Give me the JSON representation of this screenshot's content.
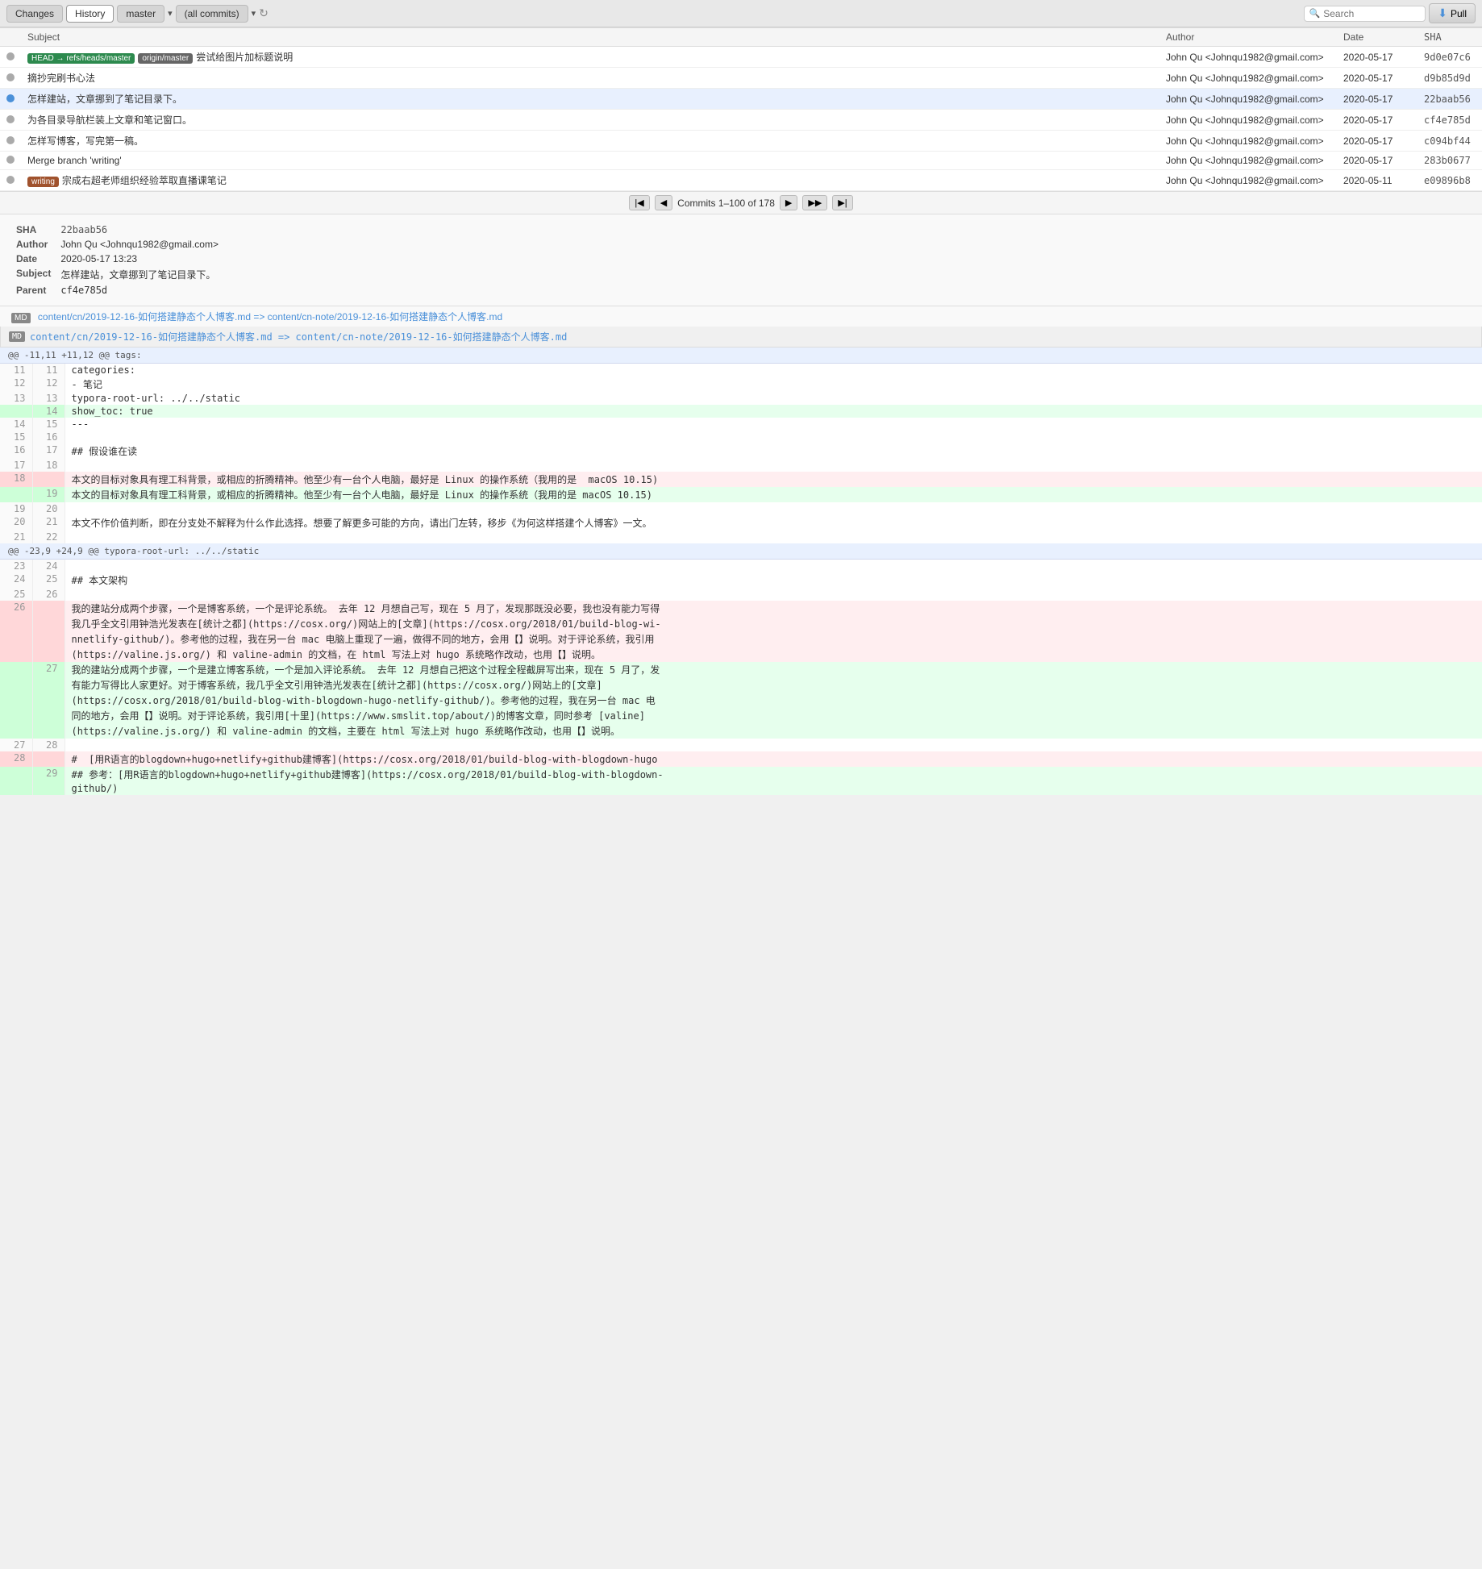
{
  "toolbar": {
    "changes_label": "Changes",
    "history_label": "History",
    "branch": "master",
    "filter": "(all commits)",
    "search_placeholder": "Search",
    "pull_label": "Pull"
  },
  "commits": {
    "columns": [
      "Subject",
      "Author",
      "Date",
      "SHA"
    ],
    "rows": [
      {
        "subject": "尝试给图片加标题说明",
        "badges": [
          {
            "text": "HEAD → refs/heads/master",
            "type": "head"
          },
          {
            "text": "origin/master",
            "type": "origin"
          }
        ],
        "author": "John Qu <Johnqu1982@gmail.com>",
        "date": "2020-05-17",
        "sha": "9d0e07c6",
        "selected": false,
        "graph": "dot"
      },
      {
        "subject": "摘抄完刷书心法",
        "badges": [],
        "author": "John Qu <Johnqu1982@gmail.com>",
        "date": "2020-05-17",
        "sha": "d9b85d9d",
        "selected": false,
        "graph": "line"
      },
      {
        "subject": "怎样建站，文章挪到了笔记目录下。",
        "badges": [],
        "author": "John Qu <Johnqu1982@gmail.com>",
        "date": "2020-05-17",
        "sha": "22baab56",
        "selected": true,
        "graph": "line"
      },
      {
        "subject": "为各目录导航栏装上文章和笔记窗口。",
        "badges": [],
        "author": "John Qu <Johnqu1982@gmail.com>",
        "date": "2020-05-17",
        "sha": "cf4e785d",
        "selected": false,
        "graph": "line"
      },
      {
        "subject": "怎样写博客，写完第一稿。",
        "badges": [],
        "author": "John Qu <Johnqu1982@gmail.com>",
        "date": "2020-05-17",
        "sha": "c094bf44",
        "selected": false,
        "graph": "line"
      },
      {
        "subject": "Merge branch 'writing'",
        "badges": [],
        "author": "John Qu <Johnqu1982@gmail.com>",
        "date": "2020-05-17",
        "sha": "283b0677",
        "selected": false,
        "graph": "merge"
      },
      {
        "subject": "宗成右超老师组织经验萃取直播课笔记",
        "badges": [
          {
            "text": "writing",
            "type": "writing"
          }
        ],
        "author": "John Qu <Johnqu1982@gmail.com>",
        "date": "2020-05-11",
        "sha": "e09896b8",
        "selected": false,
        "graph": "line"
      }
    ],
    "pagination": "Commits 1–100 of 178"
  },
  "detail": {
    "sha": "22baab56",
    "author": "John Qu <Johnqu1982@gmail.com>",
    "date": "2020-05-17 13:23",
    "subject": "怎样建站，文章挪到了笔记目录下。",
    "parent": "cf4e785d",
    "file_link": "content/cn/2019-12-16-如何搭建静态个人博客.md => content/cn-note/2019-12-16-如何搭建静态个人博客.md"
  },
  "diff": {
    "filename": "content/cn/2019-12-16-如何搭建静态个人博客.md => content/cn-note/2019-12-16-如何搭建静态个人博客.md",
    "hunks": [
      {
        "header": "@@ -11,11 +11,12 @@ tags:",
        "lines": [
          {
            "old": "11",
            "new": "11",
            "type": "ctx",
            "content": "categories:"
          },
          {
            "old": "12",
            "new": "12",
            "type": "ctx",
            "content": "- 笔记"
          },
          {
            "old": "13",
            "new": "13",
            "type": "ctx",
            "content": "typora-root-url: ../../static"
          },
          {
            "old": "",
            "new": "14",
            "type": "add",
            "content": "show_toc: true"
          },
          {
            "old": "14",
            "new": "15",
            "type": "ctx",
            "content": "---"
          },
          {
            "old": "15",
            "new": "16",
            "type": "ctx",
            "content": ""
          },
          {
            "old": "16",
            "new": "17",
            "type": "ctx",
            "content": "## 假设谁在读"
          },
          {
            "old": "17",
            "new": "18",
            "type": "ctx",
            "content": ""
          },
          {
            "old": "18",
            "new": "",
            "type": "del",
            "content": "本文的目标对象具有理工科背景，或相应的折腾精神。他至少有一台个人电脑，最好是 Linux 的操作系统（我用的是  macOS 10.15)"
          },
          {
            "old": "",
            "new": "19",
            "type": "add",
            "content": "本文的目标对象具有理工科背景，或相应的折腾精神。他至少有一台个人电脑，最好是 Linux 的操作系统（我用的是 macOS 10.15)"
          },
          {
            "old": "19",
            "new": "20",
            "type": "ctx",
            "content": ""
          },
          {
            "old": "20",
            "new": "21",
            "type": "ctx",
            "content": "本文不作价值判断，即在分支处不解释为什么作此选择。想要了解更多可能的方向，请出门左转，移步《为何这样搭建个人博客》一文。"
          },
          {
            "old": "21",
            "new": "22",
            "type": "ctx",
            "content": ""
          }
        ]
      },
      {
        "header": "@@ -23,9 +24,9 @@ typora-root-url: ../../static",
        "lines": [
          {
            "old": "23",
            "new": "24",
            "type": "ctx",
            "content": ""
          },
          {
            "old": "24",
            "new": "25",
            "type": "ctx",
            "content": "## 本文架构"
          },
          {
            "old": "25",
            "new": "26",
            "type": "ctx",
            "content": ""
          },
          {
            "old": "26",
            "new": "",
            "type": "del",
            "content": "我的建站分成两个步骤，一个是博客系统，一个是评论系统。 去年 12 月想自己写，现在 5 月了，发现那既没必要，我也没有能力写得\n我几乎全文引用钟浩光发表在[统计之都](https://cosx.org/)网站上的[文章](https://cosx.org/2018/01/build-blog-wi-\nnnetlify-github/)。参考他的过程，我在另一台 mac 电脑上重现了一遍，做得不同的地方，会用【】说明。对于评论系统，我引用\n(https://valine.js.org/) 和 valine-admin 的文档，在 html 写法上对 hugo 系统略作改动，也用【】说明。"
          },
          {
            "old": "",
            "new": "27",
            "type": "add",
            "content": "我的建站分成两个步骤，一个是建立博客系统，一个是加入评论系统。 去年 12 月想自己把这个过程全程截屏写出来，现在 5 月了，发\n有能力写得比人家更好。对于博客系统，我几乎全文引用钟浩光发表在[统计之都](https://cosx.org/)网站上的[文章]\n(https://cosx.org/2018/01/build-blog-with-blogdown-hugo-netlify-github/)。参考他的过程，我在另一台 mac 电\n同的地方，会用【】说明。对于评论系统，我引用[十里](https://www.smslit.top/about/)的博客文章，同时参考 [valine]\n(https://valine.js.org/) 和 valine-admin 的文档，主要在 html 写法上对 hugo 系统略作改动，也用【】说明。"
          },
          {
            "old": "27",
            "new": "28",
            "type": "ctx",
            "content": ""
          },
          {
            "old": "28",
            "new": "",
            "type": "del",
            "content": "#  [用R语言的blogdown+hugo+netlify+github建博客](https://cosx.org/2018/01/build-blog-with-blogdown-hugo"
          },
          {
            "old": "",
            "new": "29",
            "type": "add",
            "content": "## 参考：[用R语言的blogdown+hugo+netlify+github建博客](https://cosx.org/2018/01/build-blog-with-blogdown-\ngithub/)"
          }
        ]
      }
    ]
  },
  "labels": {
    "sha": "SHA",
    "author": "Author",
    "date": "Date",
    "subject": "Subject",
    "parent": "Parent"
  }
}
